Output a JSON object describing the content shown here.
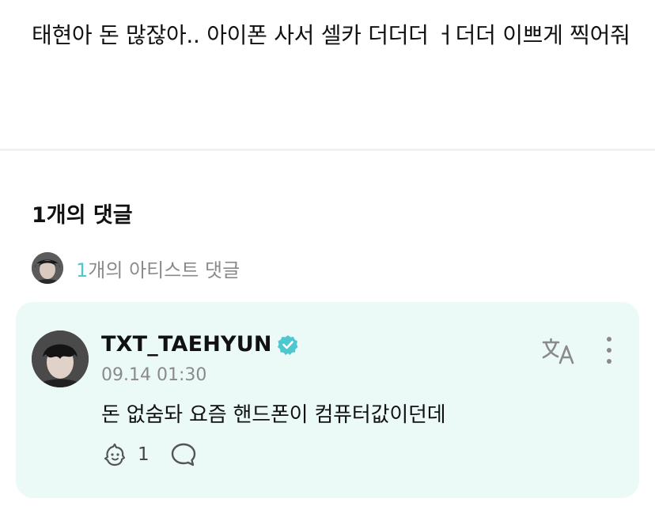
{
  "post": {
    "text": "태현아 돈 많잖아.. 아이폰 사서 셀카 더더더 ㅓ더더 이쁘게 찍어줘"
  },
  "comments": {
    "count_label": "1개의 댓글",
    "artist_count_number": "1",
    "artist_count_suffix": "개의 아티스트 댓글"
  },
  "comment": {
    "author": "TXT_TAEHYUN",
    "timestamp": "09.14 01:30",
    "text": "돈 없숨돠 요즘 핸드폰이 컴퓨터값이던데",
    "like_count": "1"
  },
  "icons": {
    "verified": "verified-badge-icon",
    "translate": "translate-icon",
    "more": "more-vertical-icon",
    "like": "like-icon",
    "reply": "speech-bubble-icon"
  },
  "colors": {
    "accent": "#4fc7cf",
    "card_bg": "#ebfaf7",
    "muted": "#8a8a8a"
  }
}
